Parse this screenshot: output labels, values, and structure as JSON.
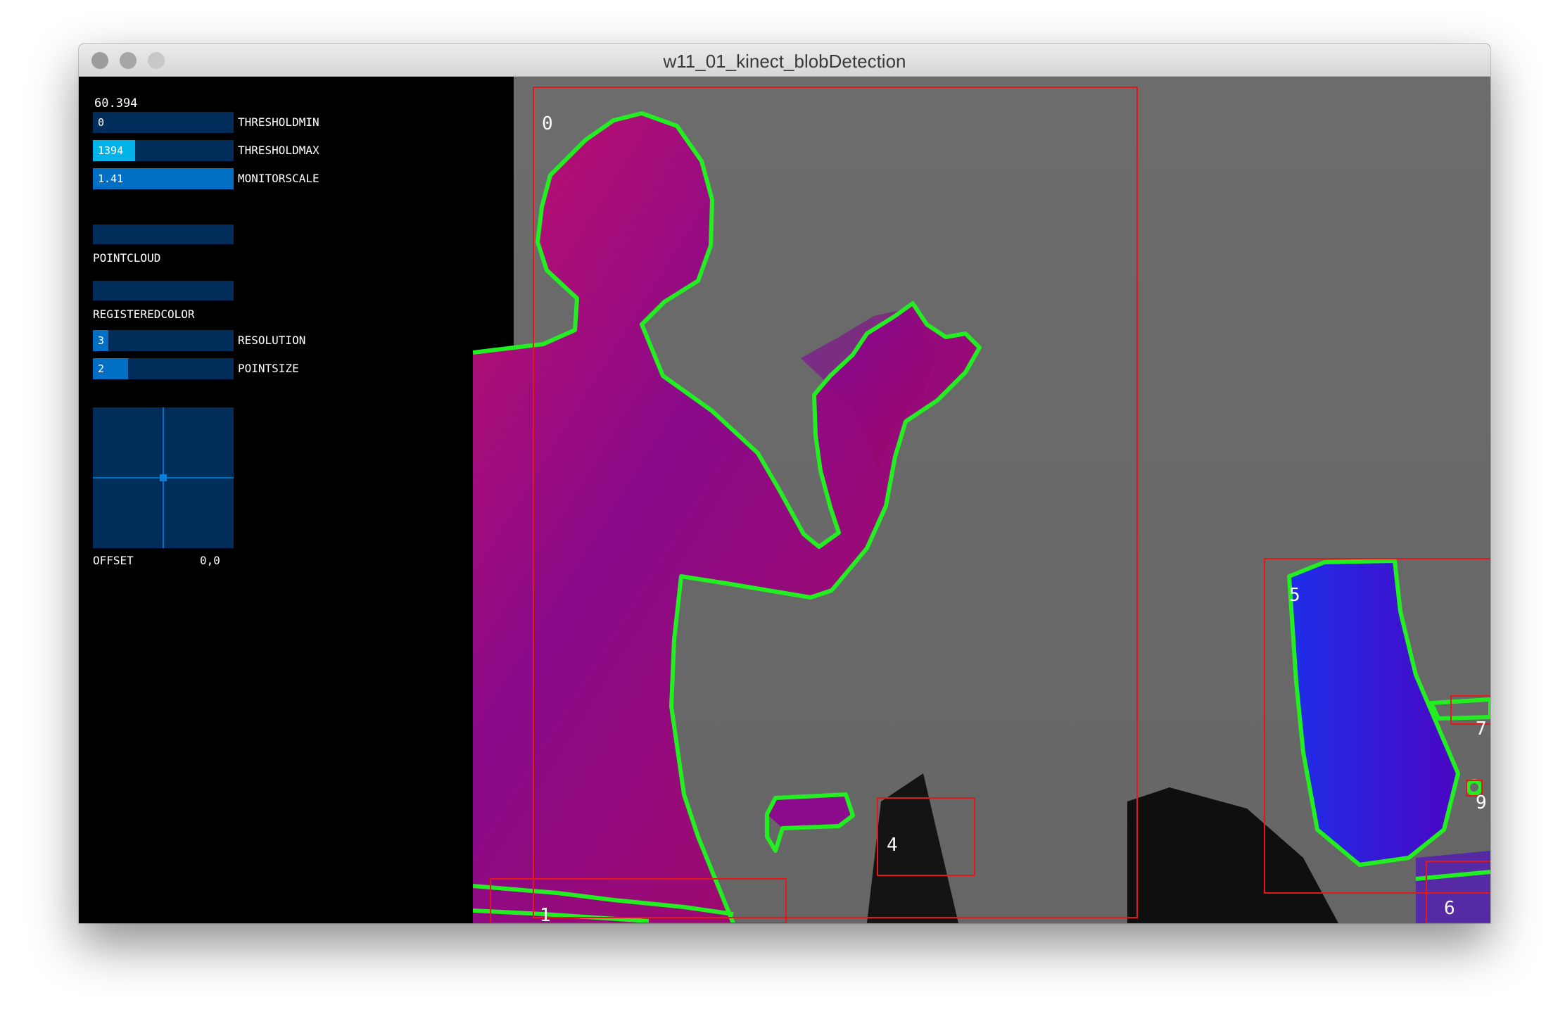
{
  "window": {
    "title": "w11_01_kinect_blobDetection"
  },
  "gui": {
    "fps": "60.394",
    "sliders": [
      {
        "label": "THRESHOLDMIN",
        "value": "0",
        "fraction": 0.0
      },
      {
        "label": "THRESHOLDMAX",
        "value": "1394",
        "fraction": 0.3
      },
      {
        "label": "MONITORSCALE",
        "value": "1.41",
        "fraction": 1.0
      }
    ],
    "toggles": [
      {
        "label": "POINTCLOUD"
      },
      {
        "label": "REGISTEREDCOLOR"
      }
    ],
    "sliders2": [
      {
        "label": "RESOLUTION",
        "value": "3",
        "fraction": 0.11
      },
      {
        "label": "POINTSIZE",
        "value": "2",
        "fraction": 0.25
      }
    ],
    "pad": {
      "label": "OFFSET",
      "value": "0,0"
    }
  },
  "blobs": {
    "labels": [
      "0",
      "1",
      "4",
      "5",
      "6",
      "7",
      "9"
    ],
    "colors": {
      "contour": "#22ee22",
      "box": "#e01a1a",
      "label": "#ffffff"
    }
  }
}
